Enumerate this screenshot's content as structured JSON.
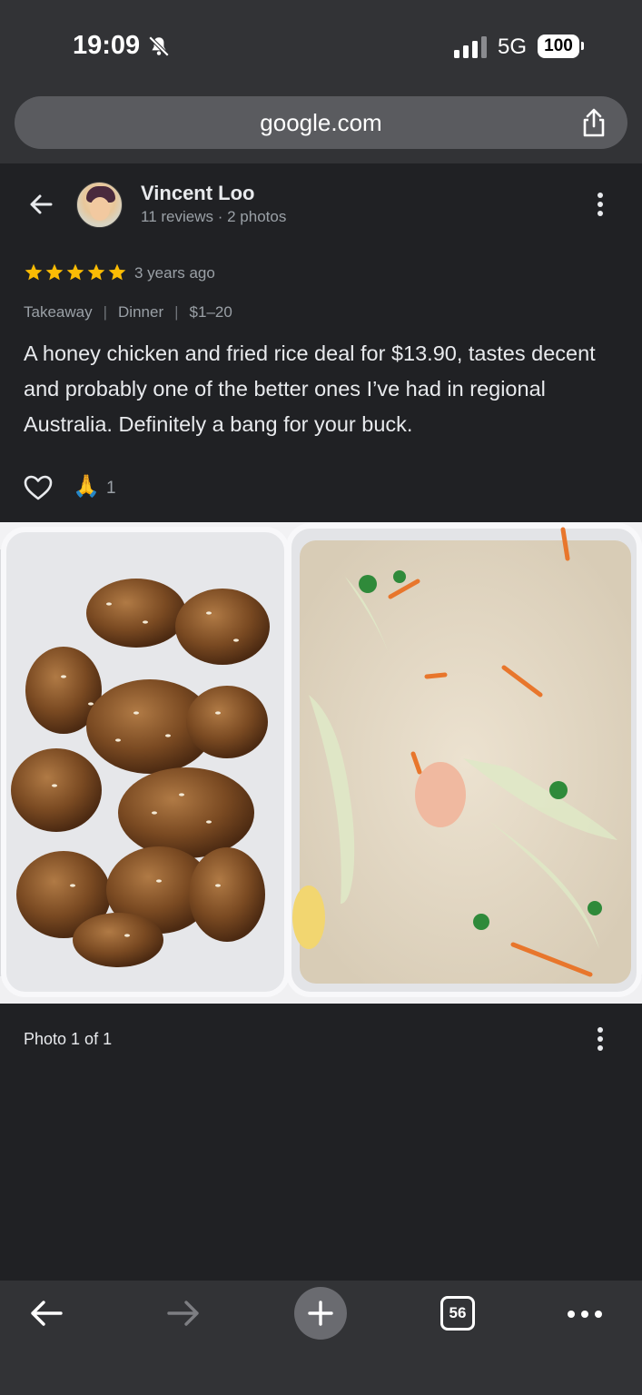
{
  "status_bar": {
    "time": "19:09",
    "network": "5G",
    "battery": "100",
    "icons": [
      "bell-slash-icon",
      "signal-icon"
    ]
  },
  "browser": {
    "url": "google.com",
    "tab_count": "56",
    "icons": [
      "share-icon",
      "back-icon",
      "forward-icon",
      "plus-icon",
      "more-horizontal-icon"
    ]
  },
  "review": {
    "reviewer_name": "Vincent Loo",
    "reviewer_meta": "11 reviews · 2 photos",
    "rating": 5,
    "date": "3 years ago",
    "tags": [
      "Takeaway",
      "Dinner",
      "$1–20"
    ],
    "text": "A honey chicken and fried rice deal for $13.90, tastes decent and probably one of the better ones I’ve had in regional Australia. Definitely a bang for your buck.",
    "reaction_emoji": "🙏",
    "reaction_count": "1",
    "star_color": "#fbbc04"
  },
  "photo": {
    "caption": "Photo 1 of 1"
  }
}
